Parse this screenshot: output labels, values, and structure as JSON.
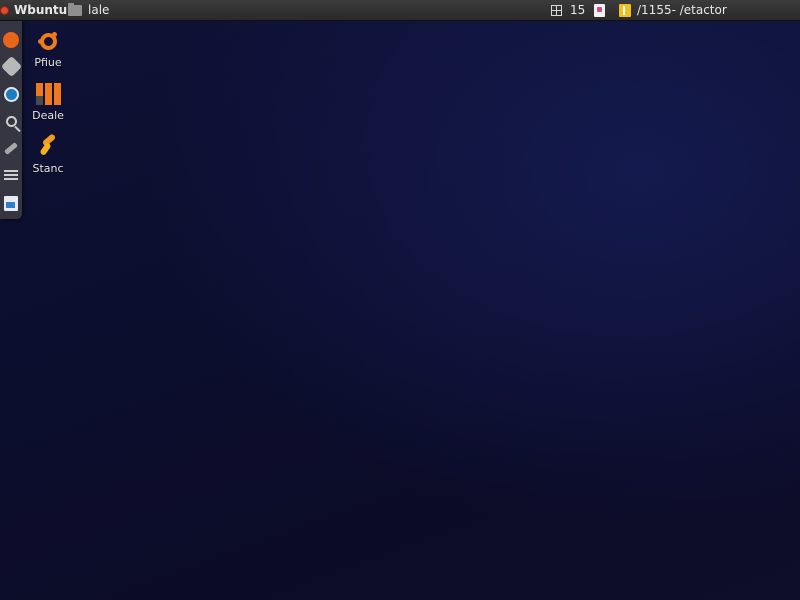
{
  "top_panel": {
    "app_name": "Wbuntu",
    "menu_label": "lale",
    "indicator_number": "15",
    "clock_text": "/1155- /etactor"
  },
  "launcher": {
    "items": [
      {
        "icon": "ubuntu-circle-icon"
      },
      {
        "icon": "gear-icon"
      },
      {
        "icon": "globe-icon"
      },
      {
        "icon": "search-icon"
      },
      {
        "icon": "tools-icon"
      },
      {
        "icon": "list-icon"
      },
      {
        "icon": "document-icon"
      }
    ]
  },
  "desktop": {
    "icons": [
      {
        "label": "Pfiue",
        "icon": "ubuntu-logo-icon"
      },
      {
        "label": "Deale",
        "icon": "bars-icon"
      },
      {
        "label": "Stanc",
        "icon": "bolt-icon"
      }
    ]
  },
  "colors": {
    "accent": "#ef7a1e",
    "panel": "#2f2f2f",
    "desktop": "#0d0f30"
  }
}
